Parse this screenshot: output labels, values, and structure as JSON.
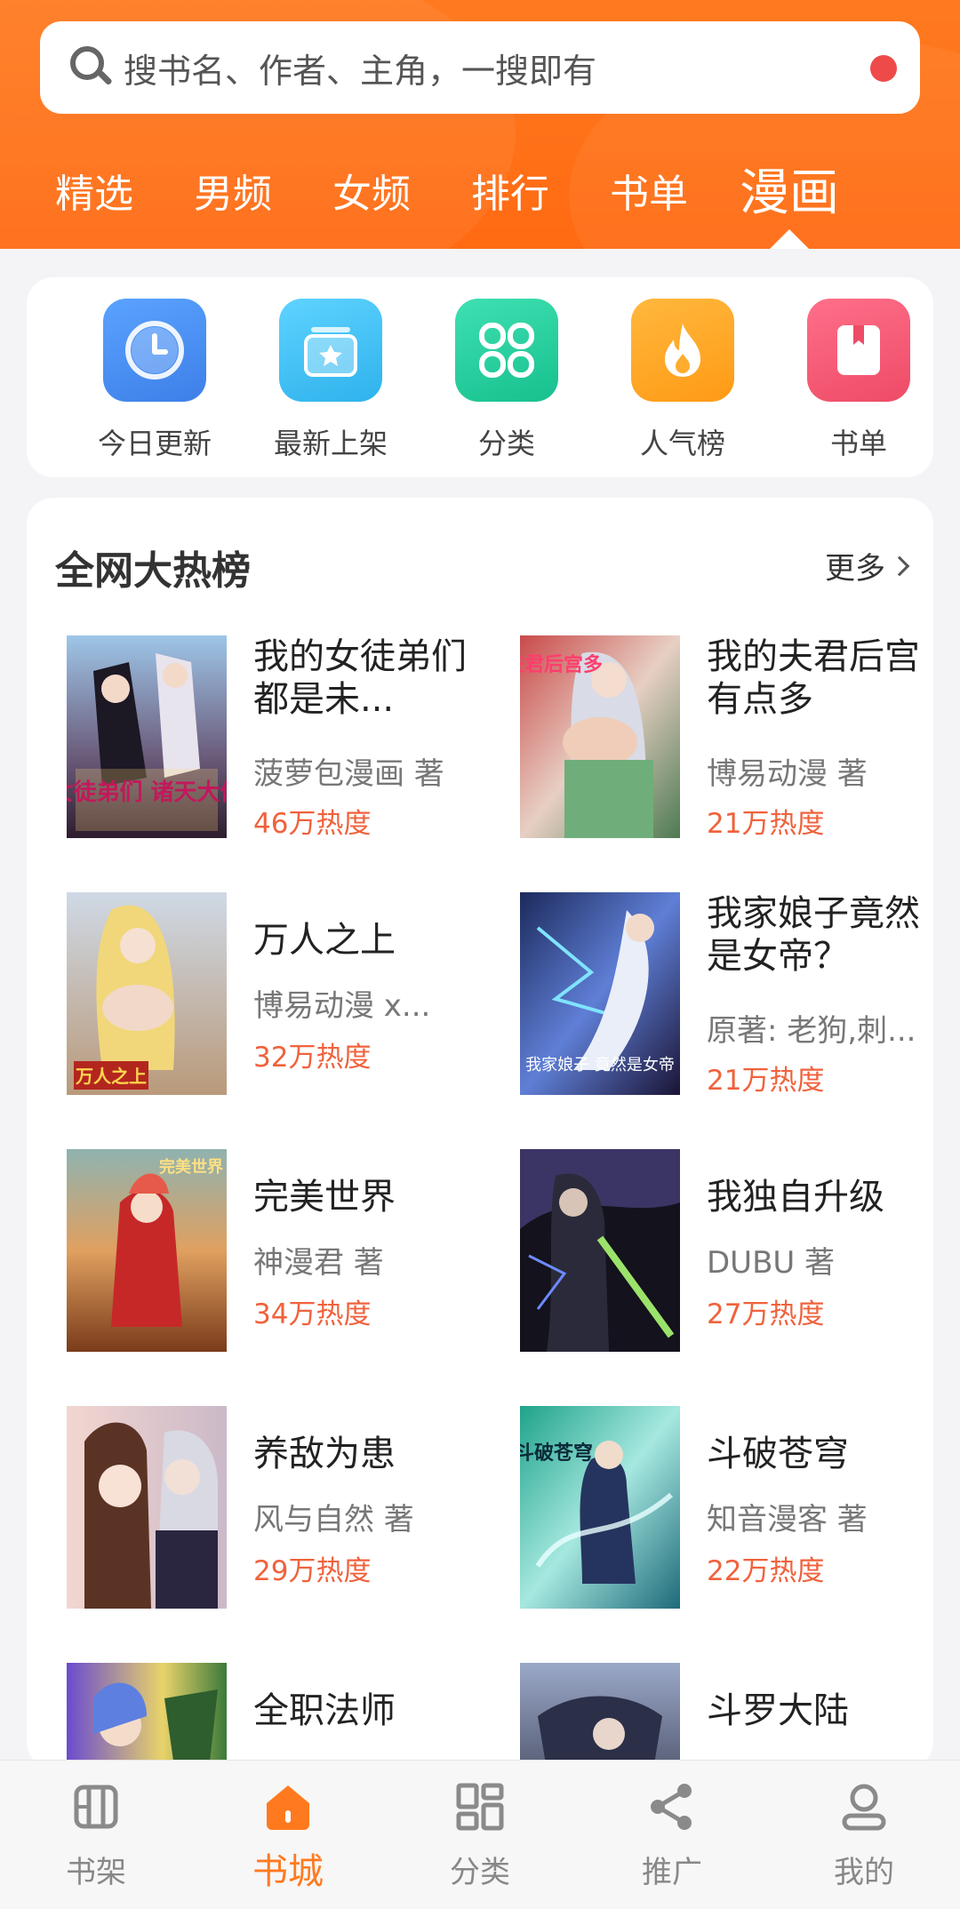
{
  "search": {
    "placeholder": "搜书名、作者、主角，一搜即有"
  },
  "top_tabs": [
    {
      "label": "精选"
    },
    {
      "label": "男频"
    },
    {
      "label": "女频"
    },
    {
      "label": "排行"
    },
    {
      "label": "书单"
    },
    {
      "label": "漫画",
      "active": true
    }
  ],
  "quick_menu": [
    {
      "label": "今日更新",
      "icon": "clock-icon",
      "color": "#4a8ff0"
    },
    {
      "label": "最新上架",
      "icon": "new-shelf-icon",
      "color": "#38bdf0"
    },
    {
      "label": "分类",
      "icon": "category-grid-icon",
      "color": "#21c99a"
    },
    {
      "label": "人气榜",
      "icon": "flame-icon",
      "color": "#ffa41e"
    },
    {
      "label": "书单",
      "icon": "bookmark-book-icon",
      "color": "#f0566e"
    }
  ],
  "hot_list": {
    "title": "全网大热榜",
    "more_label": "更多",
    "books": [
      {
        "title": "我的女徒弟们都是未...",
        "author": "菠萝包漫画 著",
        "heat": "46万热度",
        "cover_text": "女徒弟们 诸天大佬"
      },
      {
        "title": "我的夫君后宫有点多",
        "author": "博易动漫 著",
        "heat": "21万热度",
        "cover_text": "夫君后宫多"
      },
      {
        "title": "万人之上",
        "author": "博易动漫 x...",
        "heat": "32万热度",
        "cover_text": "万人之上"
      },
      {
        "title": "我家娘子竟然是女帝？",
        "author": "原著: 老狗,刺...",
        "heat": "21万热度",
        "cover_text": "我家娘子 竟然是女帝"
      },
      {
        "title": "完美世界",
        "author": "神漫君 著",
        "heat": "34万热度",
        "cover_text": "完美世界"
      },
      {
        "title": "我独自升级",
        "author": "DUBU 著",
        "heat": "27万热度",
        "cover_text": ""
      },
      {
        "title": "养敌为患",
        "author": "风与自然 著",
        "heat": "29万热度",
        "cover_text": ""
      },
      {
        "title": "斗破苍穹",
        "author": "知音漫客 著",
        "heat": "22万热度",
        "cover_text": "斗破苍穹"
      },
      {
        "title": "全职法师",
        "author": "",
        "heat": "",
        "cover_text": ""
      },
      {
        "title": "斗罗大陆",
        "author": "",
        "heat": "",
        "cover_text": ""
      }
    ]
  },
  "bottom_nav": [
    {
      "label": "书架",
      "icon": "bookshelf-icon"
    },
    {
      "label": "书城",
      "icon": "bookstore-home-icon",
      "active": true
    },
    {
      "label": "分类",
      "icon": "category-icon"
    },
    {
      "label": "推广",
      "icon": "share-icon"
    },
    {
      "label": "我的",
      "icon": "profile-icon"
    }
  ],
  "colors": {
    "accent": "#ff7a1f",
    "heat": "#f0623c"
  }
}
